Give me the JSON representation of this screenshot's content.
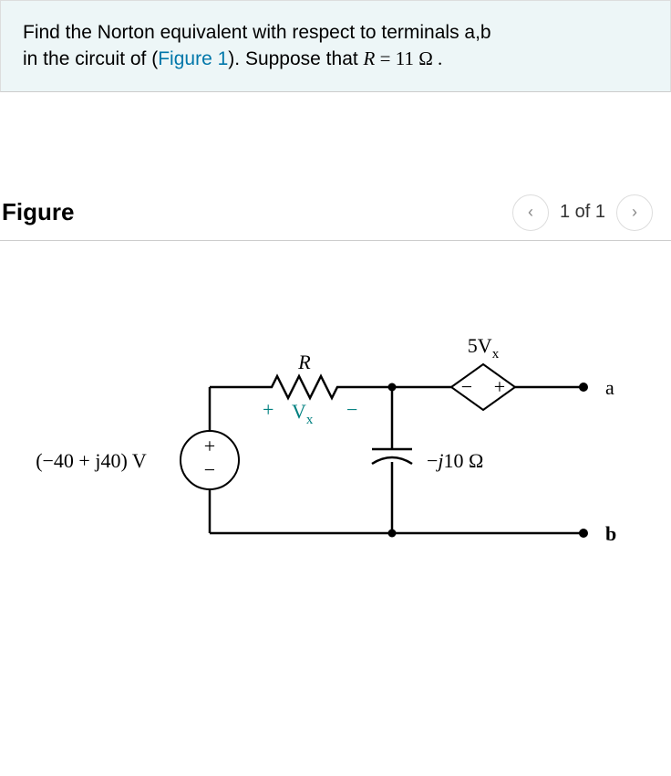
{
  "problem": {
    "line1_pre": "Find the Norton equivalent with respect to terminals a,b",
    "line2_pre": "in the circuit of (",
    "link_text": "Figure 1",
    "line2_mid": "). Suppose that ",
    "var_R": "R",
    "eq": " = 11  Ω .",
    "full_sentence_aria": "Find the Norton equivalent with respect to terminals a,b in the circuit of (Figure 1). Suppose that R = 11 Ω."
  },
  "figure": {
    "title": "Figure",
    "pager_text": "1 of 1",
    "prev_glyph": "‹",
    "next_glyph": "›"
  },
  "circuit": {
    "source_label": "(−40 + j40) V",
    "source_pos": "+",
    "source_neg": "−",
    "R_label": "R",
    "Vx_plus": "+",
    "Vx_label": "V",
    "Vx_sub": "x",
    "Vx_minus": "−",
    "cap_label": "−j10 Ω",
    "dep_label": "5V",
    "dep_sub": "x",
    "dep_neg": "−",
    "dep_pos": "+",
    "term_a": "a",
    "term_b": "b"
  }
}
